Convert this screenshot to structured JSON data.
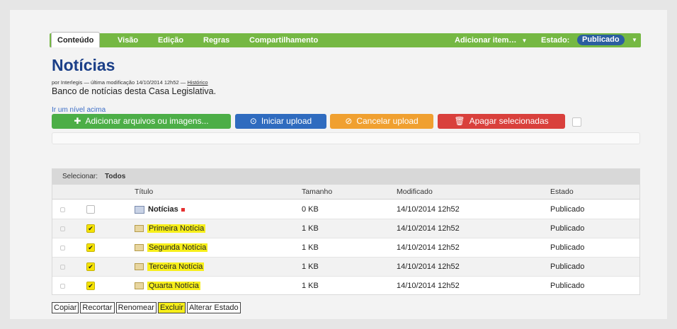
{
  "tabs": [
    {
      "label": "Conteúdo"
    },
    {
      "label": "Visão"
    },
    {
      "label": "Edição"
    },
    {
      "label": "Regras"
    },
    {
      "label": "Compartilhamento"
    }
  ],
  "menu": {
    "add_item": "Adicionar item…",
    "state_label": "Estado:",
    "state_value": "Publicado"
  },
  "page": {
    "title": "Notícias",
    "byline_prefix": "por Interlegis — última modificação 14/10/2014 12h52 —",
    "history_link": "Histórico",
    "description": "Banco de notícias desta Casa Legislativa.",
    "up_link": "Ir um nível acima"
  },
  "buttons": {
    "add_files": "Adicionar arquivos ou imagens...",
    "start_upload": "Iniciar upload",
    "cancel_upload": "Cancelar upload",
    "delete_selected": "Apagar selecionadas"
  },
  "table": {
    "select_label": "Selecionar:",
    "select_all": "Todos",
    "headers": [
      "Título",
      "Tamanho",
      "Modificado",
      "Estado"
    ],
    "rows": [
      {
        "title": "Notícias",
        "size": "0 KB",
        "modified": "14/10/2014 12h52",
        "state": "Publicado",
        "checked": false
      },
      {
        "title": "Primeira Notícia",
        "size": "1 KB",
        "modified": "14/10/2014 12h52",
        "state": "Publicado",
        "checked": true
      },
      {
        "title": "Segunda Notícia",
        "size": "1 KB",
        "modified": "14/10/2014 12h52",
        "state": "Publicado",
        "checked": true
      },
      {
        "title": "Terceira Notícia",
        "size": "1 KB",
        "modified": "14/10/2014 12h52",
        "state": "Publicado",
        "checked": true
      },
      {
        "title": "Quarta Notícia",
        "size": "1 KB",
        "modified": "14/10/2014 12h52",
        "state": "Publicado",
        "checked": true
      }
    ]
  },
  "actions": [
    "Copiar",
    "Recortar",
    "Renomear",
    "Excluir",
    "Alterar Estado"
  ],
  "colors": {
    "tab_green": "#75b843",
    "btn_green": "#4cae47",
    "btn_blue": "#2f6bbf",
    "btn_orange": "#f0a030",
    "btn_red": "#d9403c",
    "title_blue": "#1b3f88",
    "highlight": "#f7ef1a"
  }
}
